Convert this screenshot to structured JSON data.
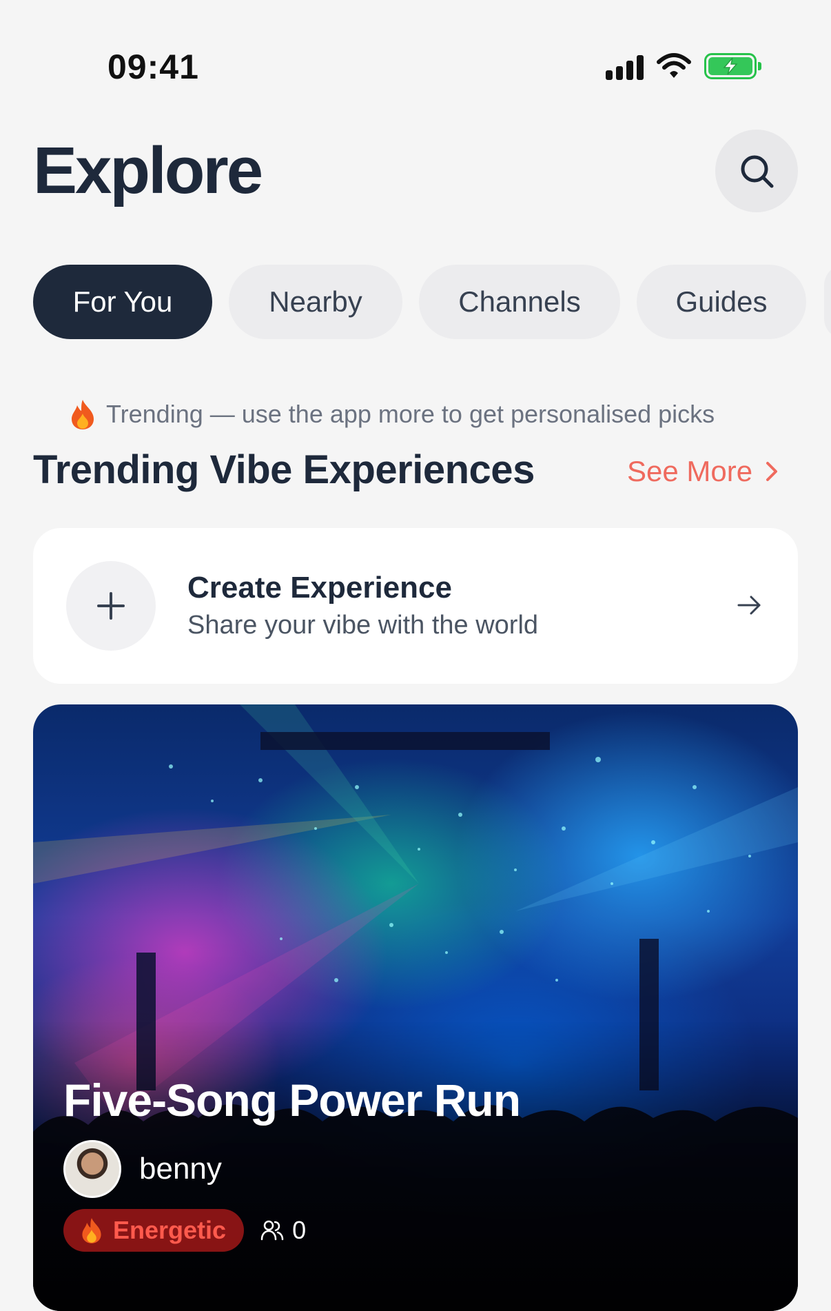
{
  "status_bar": {
    "time": "09:41"
  },
  "header": {
    "title": "Explore"
  },
  "tabs": [
    {
      "label": "For You"
    },
    {
      "label": "Nearby"
    },
    {
      "label": "Channels"
    },
    {
      "label": "Guides"
    }
  ],
  "trending": {
    "note": "Trending — use the app more to get personalised picks",
    "title": "Trending Vibe Experiences",
    "see_more": "See More"
  },
  "create_card": {
    "title": "Create Experience",
    "subtitle": "Share your vibe with the world"
  },
  "experience": {
    "title": "Five-Song Power Run",
    "creator": "benny",
    "mood": "Energetic",
    "members": "0"
  },
  "colors": {
    "accent": "#ef6a5e",
    "dark": "#1e293b",
    "background": "#f5f5f5",
    "battery": "#34c759"
  },
  "icons": [
    "signal-icon",
    "wifi-icon",
    "battery-icon",
    "search-icon",
    "fire-icon",
    "chevron-right-icon",
    "plus-icon",
    "arrow-right-icon",
    "users-icon"
  ]
}
